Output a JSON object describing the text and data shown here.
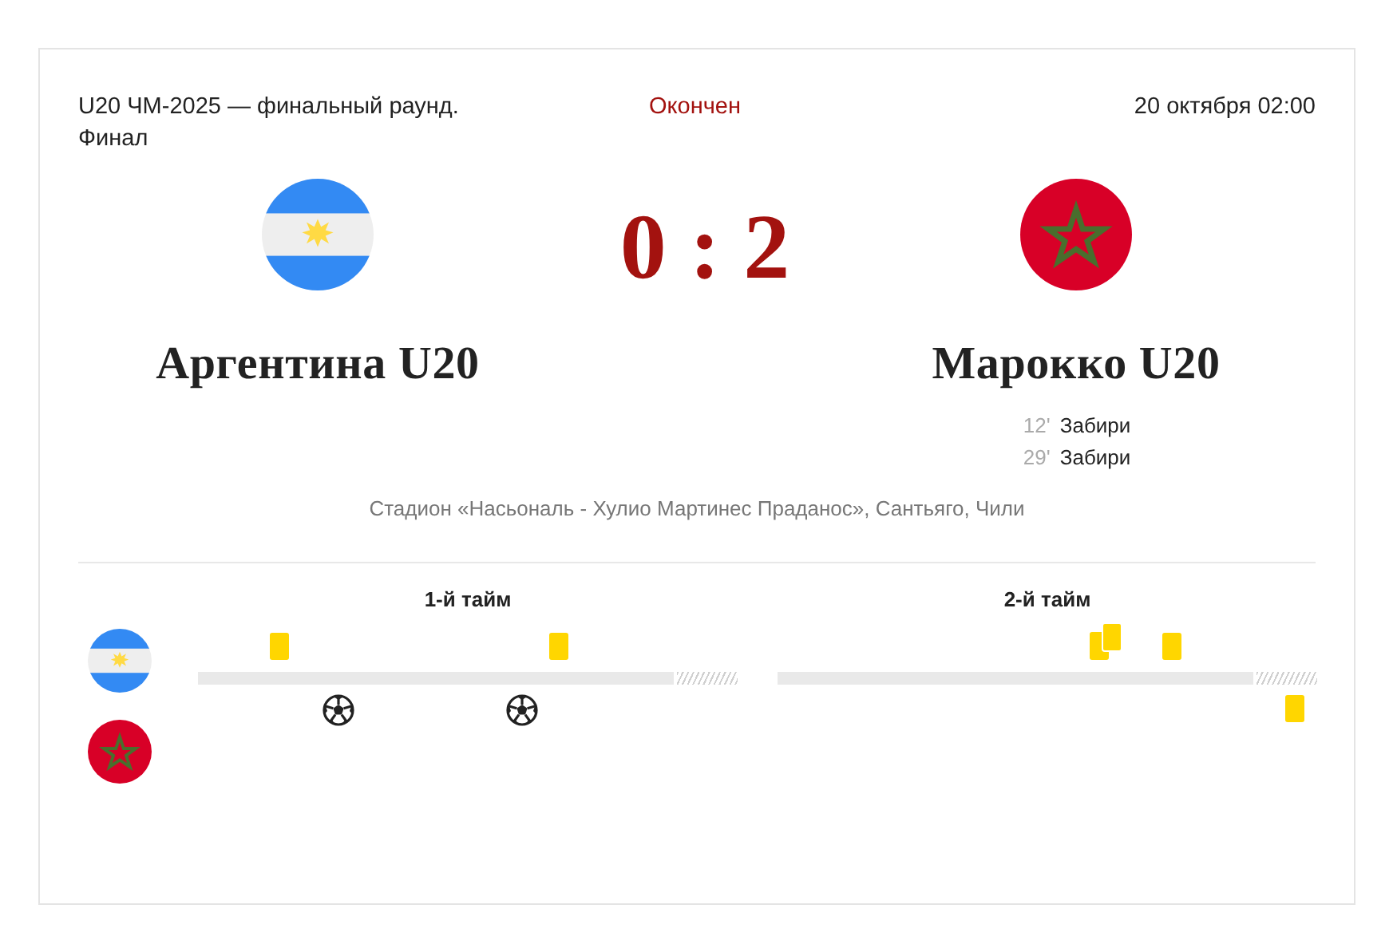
{
  "header": {
    "tournament": "U20 ЧМ-2025 — финальный раунд. Финал",
    "status": "Окончен",
    "datetime": "20 октября 02:00"
  },
  "teams": [
    {
      "name": "Аргентина U20",
      "kind": "argentina"
    },
    {
      "name": "Марокко U20",
      "kind": "morocco",
      "goals": [
        {
          "minute": "12'",
          "player": "Забири"
        },
        {
          "minute": "29'",
          "player": "Забири"
        }
      ]
    }
  ],
  "score": "0 : 2",
  "venue": "Стадион «Насьональ - Хулио Мартинес Праданос», Сантьяго, Чили",
  "timeline": {
    "halves": [
      {
        "label": "1-й тайм",
        "home_events": [
          {
            "kind": "card"
          },
          {
            "kind": "card"
          }
        ],
        "away_events": [
          {
            "kind": "goal"
          },
          {
            "kind": "goal"
          }
        ]
      },
      {
        "label": "2-й тайм",
        "home_events": [
          {
            "kind": "second_card"
          },
          {
            "kind": "card"
          }
        ],
        "away_events": [
          {
            "kind": "card"
          }
        ]
      }
    ]
  }
}
